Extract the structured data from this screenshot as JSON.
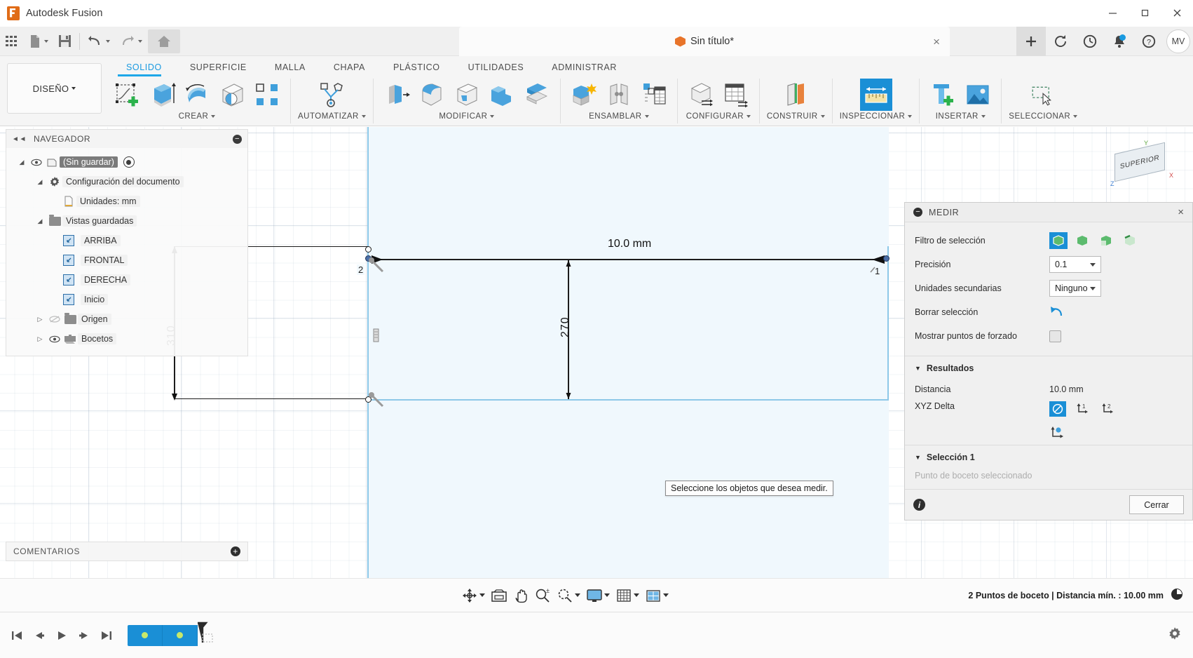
{
  "titlebar": {
    "app_title": "Autodesk Fusion",
    "logo_icon": "fusion-logo-icon",
    "minimize_icon": "minimize-icon",
    "maximize_icon": "maximize-restore-icon",
    "close_icon": "close-icon"
  },
  "quick_access": {
    "grid_label": "app-grid-icon",
    "new_label": "new-document-icon",
    "save_label": "save-icon",
    "undo_label": "undo-icon",
    "redo_label": "redo-icon",
    "home_label": "home-icon",
    "document_tab": {
      "title": "Sin título*",
      "close": "×"
    },
    "right_icons": [
      "plus-icon",
      "refresh-icon",
      "history-icon",
      "notifications-icon",
      "help-icon"
    ],
    "avatar_initials": "MV"
  },
  "ribbon": {
    "workspace": "DISEÑO",
    "tabs": [
      {
        "label": "SOLIDO",
        "active": true
      },
      {
        "label": "SUPERFICIE",
        "active": false
      },
      {
        "label": "MALLA",
        "active": false
      },
      {
        "label": "CHAPA",
        "active": false
      },
      {
        "label": "PLÁSTICO",
        "active": false
      },
      {
        "label": "UTILIDADES",
        "active": false
      },
      {
        "label": "ADMINISTRAR",
        "active": false
      }
    ],
    "groups": [
      {
        "label": "CREAR",
        "icons": [
          "create-sketch-icon",
          "extrude-icon",
          "revolve-icon",
          "hole-icon",
          "pattern-icon"
        ]
      },
      {
        "label": "AUTOMATIZAR",
        "icons": [
          "automate-icon"
        ]
      },
      {
        "label": "MODIFICAR",
        "icons": [
          "press-pull-icon",
          "fillet-icon",
          "shell-icon",
          "combine-icon",
          "split-face-icon"
        ]
      },
      {
        "label": "ENSAMBLAR",
        "icons": [
          "new-component-icon",
          "joint-icon",
          "assembly-table-icon"
        ]
      },
      {
        "label": "CONFIGURAR",
        "icons": [
          "configure-model-icon",
          "configure-table-icon"
        ]
      },
      {
        "label": "CONSTRUIR",
        "icons": [
          "construct-plane-icon"
        ]
      },
      {
        "label": "INSPECCIONAR",
        "icons": [
          "measure-icon"
        ],
        "active": true
      },
      {
        "label": "INSERTAR",
        "icons": [
          "insert-mcmaster-icon",
          "insert-image-icon"
        ]
      },
      {
        "label": "SELECCIONAR",
        "icons": [
          "select-window-icon"
        ]
      }
    ]
  },
  "navigator": {
    "title": "NAVEGADOR",
    "collapse_icon": "collapse-left-icon",
    "minimize_icon": "minus-circle-icon",
    "items": [
      {
        "label": "(Sin guardar)",
        "level": 0,
        "selected": true,
        "eye": true,
        "triangle": "down",
        "icon": "component-icon",
        "radio": true
      },
      {
        "label": "Configuración del documento",
        "level": 1,
        "selected": false,
        "eye": false,
        "triangle": "down",
        "icon": "gear-icon",
        "radio": false
      },
      {
        "label": "Unidades: mm",
        "level": 2,
        "selected": false,
        "eye": false,
        "triangle": "none",
        "icon": "units-doc-icon",
        "radio": false
      },
      {
        "label": "Vistas guardadas",
        "level": 1,
        "selected": false,
        "eye": false,
        "triangle": "down",
        "icon": "folder-icon",
        "radio": false
      },
      {
        "label": "ARRIBA",
        "level": 2,
        "selected": false,
        "eye": false,
        "triangle": "none",
        "icon": "saved-view-icon",
        "radio": false
      },
      {
        "label": "FRONTAL",
        "level": 2,
        "selected": false,
        "eye": false,
        "triangle": "none",
        "icon": "saved-view-icon",
        "radio": false
      },
      {
        "label": "DERECHA",
        "level": 2,
        "selected": false,
        "eye": false,
        "triangle": "none",
        "icon": "saved-view-icon",
        "radio": false
      },
      {
        "label": "Inicio",
        "level": 2,
        "selected": false,
        "eye": false,
        "triangle": "none",
        "icon": "saved-view-icon",
        "radio": false
      },
      {
        "label": "Origen",
        "level": 1,
        "selected": false,
        "eye": true,
        "eye_off": true,
        "triangle": "right",
        "icon": "folder-icon",
        "radio": false
      },
      {
        "label": "Bocetos",
        "level": 1,
        "selected": false,
        "eye": true,
        "eye_off": false,
        "triangle": "right",
        "icon": "sketch-folder-icon",
        "radio": false
      }
    ]
  },
  "comments": {
    "title": "COMENTARIOS",
    "add_icon": "plus-circle-icon"
  },
  "canvas": {
    "dimension_top": "10.0 mm",
    "dimension_left": "310",
    "dimension_mid": "270",
    "point_label_1": "1",
    "point_label_2": "2",
    "tooltip": "Seleccione los objetos que desea medir.",
    "viewcube_face": "SUPERIOR",
    "viewcube_axes": {
      "x": "X",
      "y": "Y",
      "z": "Z"
    }
  },
  "measure_panel": {
    "title": "MEDIR",
    "close_icon": "panel-close-icon",
    "rows": [
      {
        "label": "Filtro de selección",
        "type": "filter"
      },
      {
        "label": "Precisión",
        "type": "select",
        "value": "0.1"
      },
      {
        "label": "Unidades secundarias",
        "type": "select",
        "value": "Ninguno"
      },
      {
        "label": "Borrar selección",
        "type": "action",
        "icon": "undo-arrow-icon"
      },
      {
        "label": "Mostrar puntos de forzado",
        "type": "checkbox",
        "checked": false
      }
    ],
    "results": {
      "title": "Resultados",
      "distance_label": "Distancia",
      "distance_value": "10.0 mm",
      "xyz_label": "XYZ Delta",
      "xyz_icons": [
        "no-delta-icon",
        "delta-1-icon",
        "delta-2-icon",
        "delta-global-icon"
      ]
    },
    "selection": {
      "title": "Selección 1",
      "hint": "Punto de boceto seleccionado"
    },
    "footer": {
      "info_icon": "info-icon",
      "close_button": "Cerrar"
    },
    "accent_color": "#1a8fd6"
  },
  "nav_toolbar": {
    "buttons": [
      {
        "icon": "orbit-icon",
        "caret": true
      },
      {
        "icon": "look-at-icon",
        "caret": false
      },
      {
        "icon": "pan-icon",
        "caret": false
      },
      {
        "icon": "zoom-icon",
        "caret": false
      },
      {
        "icon": "fit-icon",
        "caret": true
      },
      {
        "icon": "display-settings-icon",
        "caret": true
      },
      {
        "icon": "grid-snap-icon",
        "caret": true
      },
      {
        "icon": "viewports-icon",
        "caret": true
      }
    ],
    "status_text": "2 Puntos de boceto | Distancia mín. : 10.00 mm",
    "status_icon": "progress-icon"
  },
  "timeline": {
    "buttons": [
      "go-to-start-icon",
      "step-back-icon",
      "play-icon",
      "step-forward-icon",
      "go-to-end-icon"
    ],
    "features": [
      "sketch-feature-1",
      "sketch-feature-2"
    ],
    "marker_icon": "timeline-marker-icon",
    "settings_icon": "timeline-settings-icon"
  }
}
